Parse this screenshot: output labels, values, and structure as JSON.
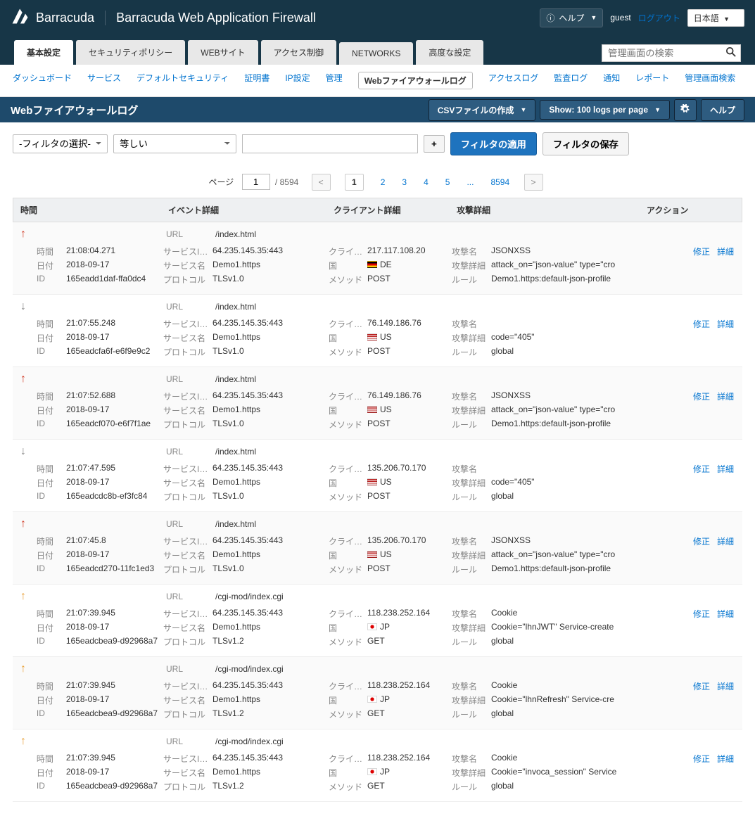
{
  "header": {
    "brand": "Barracuda",
    "product": "Barracuda Web Application Firewall",
    "help": "ヘルプ",
    "user_label": "guest",
    "logout": "ログアウト",
    "language": "日本語"
  },
  "tabs": [
    "基本設定",
    "セキュリティポリシー",
    "WEBサイト",
    "アクセス制御",
    "NETWORKS",
    "高度な設定"
  ],
  "active_tab": 0,
  "search_placeholder": "管理画面の検索",
  "subnav": [
    "ダッシュボード",
    "サービス",
    "デフォルトセキュリティ",
    "証明書",
    "IP設定",
    "管理",
    "Webファイアウォールログ",
    "アクセスログ",
    "監査ログ",
    "通知",
    "レポート",
    "管理画面検索"
  ],
  "subnav_active": 6,
  "page_title": "Webファイアウォールログ",
  "toolbar": {
    "csv": "CSVファイルの作成",
    "show": "Show: 100 logs per page",
    "help": "ヘルプ"
  },
  "filter": {
    "select_filter": "-フィルタの選択-",
    "equals": "等しい",
    "apply": "フィルタの適用",
    "save": "フィルタの保存"
  },
  "pagination": {
    "label": "ページ",
    "current": "1",
    "total": "/ 8594",
    "pages": [
      "1",
      "2",
      "3",
      "4",
      "5",
      "...",
      "8594"
    ]
  },
  "columns": {
    "time": "時間",
    "event": "イベント詳細",
    "client": "クライアント詳細",
    "attack": "攻撃詳細",
    "action": "アクション"
  },
  "labels": {
    "time": "時間",
    "date": "日付",
    "id": "ID",
    "url": "URL",
    "service_ip": "サービスIP:ポー",
    "service": "サービス名",
    "protocol": "プロトコル",
    "client_ip": "クライアントIP",
    "country": "国",
    "method": "メソッド",
    "attack_name": "攻撃名",
    "attack_detail": "攻撃詳細",
    "rule": "ルール",
    "fix": "修正",
    "detail": "詳細"
  },
  "rows": [
    {
      "arrow": "up-red",
      "time": "21:08:04.271",
      "date": "2018-09-17",
      "id": "165eadd1daf-ffa0dc4",
      "url": "/index.html",
      "sip": "64.235.145.35:443",
      "svc": "Demo1.https",
      "proto": "TLSv1.0",
      "cip": "217.117.108.20",
      "cc": "DE",
      "flag": "de",
      "method": "POST",
      "aname": "JSONXSS",
      "adetail": "attack_on=\"json-value\" type=\"cro",
      "rule": "Demo1.https:default-json-profile"
    },
    {
      "arrow": "down-gray",
      "time": "21:07:55.248",
      "date": "2018-09-17",
      "id": "165eadcfa6f-e6f9e9c2",
      "url": "/index.html",
      "sip": "64.235.145.35:443",
      "svc": "Demo1.https",
      "proto": "TLSv1.0",
      "cip": "76.149.186.76",
      "cc": "US",
      "flag": "us",
      "method": "POST",
      "aname": "",
      "adetail": "code=\"405\"",
      "rule": "global"
    },
    {
      "arrow": "up-red",
      "time": "21:07:52.688",
      "date": "2018-09-17",
      "id": "165eadcf070-e6f7f1ae",
      "url": "/index.html",
      "sip": "64.235.145.35:443",
      "svc": "Demo1.https",
      "proto": "TLSv1.0",
      "cip": "76.149.186.76",
      "cc": "US",
      "flag": "us",
      "method": "POST",
      "aname": "JSONXSS",
      "adetail": "attack_on=\"json-value\" type=\"cro",
      "rule": "Demo1.https:default-json-profile"
    },
    {
      "arrow": "down-gray",
      "time": "21:07:47.595",
      "date": "2018-09-17",
      "id": "165eadcdc8b-ef3fc84",
      "url": "/index.html",
      "sip": "64.235.145.35:443",
      "svc": "Demo1.https",
      "proto": "TLSv1.0",
      "cip": "135.206.70.170",
      "cc": "US",
      "flag": "us",
      "method": "POST",
      "aname": "",
      "adetail": "code=\"405\"",
      "rule": "global"
    },
    {
      "arrow": "up-red",
      "time": "21:07:45.8",
      "date": "2018-09-17",
      "id": "165eadcd270-11fc1ed3",
      "url": "/index.html",
      "sip": "64.235.145.35:443",
      "svc": "Demo1.https",
      "proto": "TLSv1.0",
      "cip": "135.206.70.170",
      "cc": "US",
      "flag": "us",
      "method": "POST",
      "aname": "JSONXSS",
      "adetail": "attack_on=\"json-value\" type=\"cro",
      "rule": "Demo1.https:default-json-profile"
    },
    {
      "arrow": "up-orange",
      "time": "21:07:39.945",
      "date": "2018-09-17",
      "id": "165eadcbea9-d92968a7",
      "url": "/cgi-mod/index.cgi",
      "sip": "64.235.145.35:443",
      "svc": "Demo1.https",
      "proto": "TLSv1.2",
      "cip": "118.238.252.164",
      "cc": "JP",
      "flag": "jp",
      "method": "GET",
      "aname": "Cookie",
      "adetail": "Cookie=\"lhnJWT\" Service-create",
      "rule": "global"
    },
    {
      "arrow": "up-orange",
      "time": "21:07:39.945",
      "date": "2018-09-17",
      "id": "165eadcbea9-d92968a7",
      "url": "/cgi-mod/index.cgi",
      "sip": "64.235.145.35:443",
      "svc": "Demo1.https",
      "proto": "TLSv1.2",
      "cip": "118.238.252.164",
      "cc": "JP",
      "flag": "jp",
      "method": "GET",
      "aname": "Cookie",
      "adetail": "Cookie=\"lhnRefresh\" Service-cre",
      "rule": "global"
    },
    {
      "arrow": "up-orange",
      "time": "21:07:39.945",
      "date": "2018-09-17",
      "id": "165eadcbea9-d92968a7",
      "url": "/cgi-mod/index.cgi",
      "sip": "64.235.145.35:443",
      "svc": "Demo1.https",
      "proto": "TLSv1.2",
      "cip": "118.238.252.164",
      "cc": "JP",
      "flag": "jp",
      "method": "GET",
      "aname": "Cookie",
      "adetail": "Cookie=\"invoca_session\" Service",
      "rule": "global"
    }
  ]
}
